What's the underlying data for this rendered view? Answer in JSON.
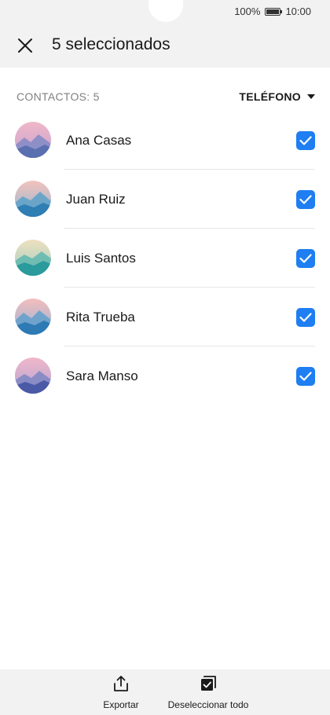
{
  "status_bar": {
    "battery": "100%",
    "time": "10:00"
  },
  "header": {
    "title": "5 seleccionados",
    "close_icon": "close-icon"
  },
  "list_header": {
    "count": "CONTACTOS: 5",
    "sort": "TELÉFONO"
  },
  "contacts": [
    {
      "name": "Ana Casas",
      "checked": true,
      "avatar_colors": [
        "#e8a7b8",
        "#5a6fb0"
      ]
    },
    {
      "name": "Juan Ruiz",
      "checked": true,
      "avatar_colors": [
        "#f0b5b0",
        "#2f7eb4"
      ]
    },
    {
      "name": "Luis Santos",
      "checked": true,
      "avatar_colors": [
        "#e9d9b0",
        "#2a9a9c"
      ]
    },
    {
      "name": "Rita Trueba",
      "checked": true,
      "avatar_colors": [
        "#f2aeb0",
        "#2d7ab4"
      ]
    },
    {
      "name": "Sara Manso",
      "checked": true,
      "avatar_colors": [
        "#e9a9be",
        "#4a5aa6"
      ]
    }
  ],
  "bottom_bar": {
    "export_label": "Exportar",
    "deselect_label": "Deseleccionar todo"
  },
  "colors": {
    "accent": "#1e7ef2",
    "bar_bg": "#f2f2f2",
    "divider": "#e6e6e6"
  }
}
